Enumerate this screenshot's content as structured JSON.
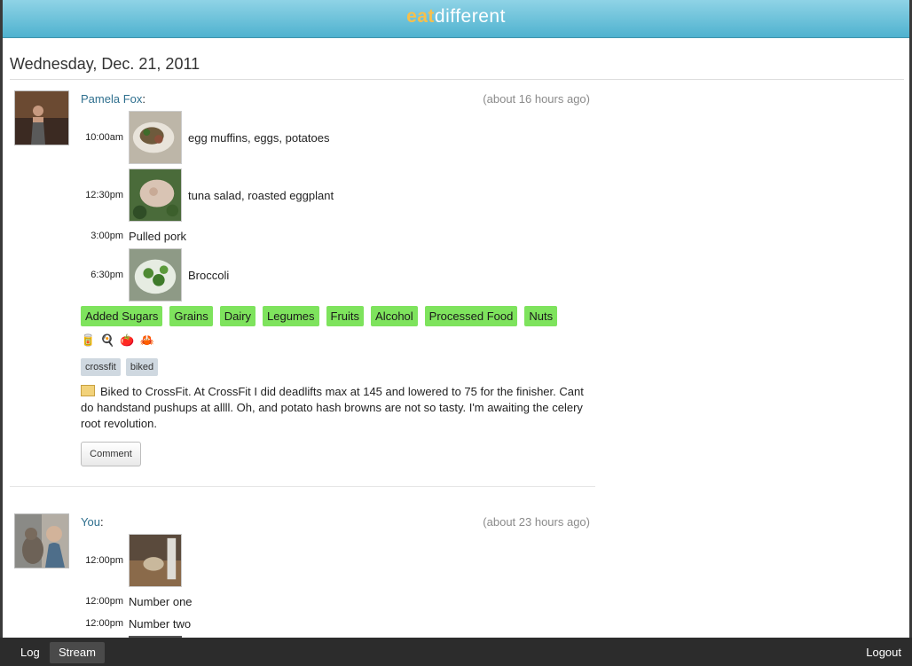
{
  "header": {
    "logo_part1": "eat",
    "logo_part2": "different"
  },
  "stream": {
    "date_heading": "Wednesday, Dec. 21, 2011",
    "posts": [
      {
        "author": "Pamela Fox",
        "author_suffix": ":",
        "time_ago": "(about 16 hours ago)",
        "meals": [
          {
            "time": "10:00am",
            "desc": "egg muffins, eggs, potatoes",
            "has_photo": true
          },
          {
            "time": "12:30pm",
            "desc": "tuna salad, roasted eggplant",
            "has_photo": true
          },
          {
            "time": "3:00pm",
            "desc": "Pulled pork",
            "has_photo": false
          },
          {
            "time": "6:30pm",
            "desc": "Broccoli",
            "has_photo": true
          }
        ],
        "categories": [
          "Added Sugars",
          "Grains",
          "Dairy",
          "Legumes",
          "Fruits",
          "Alcohol",
          "Processed Food",
          "Nuts"
        ],
        "emojis": [
          "🥫",
          "🍳",
          "🍅",
          "🦀"
        ],
        "tags": [
          "crossfit",
          "biked"
        ],
        "note": "Biked to CrossFit. At CrossFit I did deadlifts max at 145 and lowered to 75 for the finisher. Cant do handstand pushups at allll. Oh, and potato hash browns are not so tasty. I'm awaiting the celery root revolution.",
        "comment_label": "Comment"
      },
      {
        "author": "You",
        "author_suffix": ":",
        "time_ago": "(about 23 hours ago)",
        "meals": [
          {
            "time": "12:00pm",
            "desc": "",
            "has_photo": true
          },
          {
            "time": "12:00pm",
            "desc": "Number one",
            "has_photo": false
          },
          {
            "time": "12:00pm",
            "desc": "Number two",
            "has_photo": false
          }
        ]
      }
    ]
  },
  "bottom_nav": {
    "log_label": "Log",
    "stream_label": "Stream",
    "logout_label": "Logout",
    "active": "Stream"
  },
  "colors": {
    "category_green": "#7ee35d",
    "header_blue": "#4fb2cf",
    "logo_orange": "#f6c04c",
    "link_blue": "#2e6f8e"
  }
}
